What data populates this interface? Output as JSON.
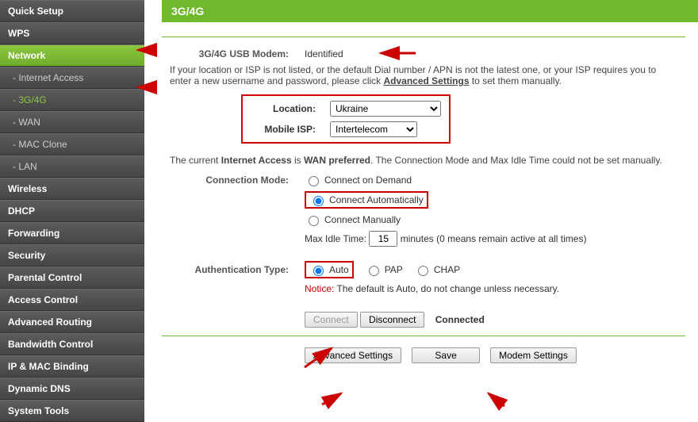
{
  "sidebar": {
    "items": [
      {
        "label": "Quick Setup",
        "type": "top"
      },
      {
        "label": "WPS",
        "type": "top"
      },
      {
        "label": "Network",
        "type": "top",
        "active_parent": true
      },
      {
        "label": "- Internet Access",
        "type": "sub"
      },
      {
        "label": "- 3G/4G",
        "type": "sub",
        "active_sub": true
      },
      {
        "label": "- WAN",
        "type": "sub"
      },
      {
        "label": "- MAC Clone",
        "type": "sub"
      },
      {
        "label": "- LAN",
        "type": "sub"
      },
      {
        "label": "Wireless",
        "type": "top"
      },
      {
        "label": "DHCP",
        "type": "top"
      },
      {
        "label": "Forwarding",
        "type": "top"
      },
      {
        "label": "Security",
        "type": "top"
      },
      {
        "label": "Parental Control",
        "type": "top"
      },
      {
        "label": "Access Control",
        "type": "top"
      },
      {
        "label": "Advanced Routing",
        "type": "top"
      },
      {
        "label": "Bandwidth Control",
        "type": "top"
      },
      {
        "label": "IP & MAC Binding",
        "type": "top"
      },
      {
        "label": "Dynamic DNS",
        "type": "top"
      },
      {
        "label": "System Tools",
        "type": "top"
      }
    ]
  },
  "page": {
    "title": "3G/4G",
    "modem_label": "3G/4G USB Modem:",
    "modem_status": "Identified",
    "note_line_a": "If your location or ISP is not listed, or the default Dial number / APN is not the latest one, or your ISP requires you to",
    "note_line_b_a": "enter a new username and password, please click ",
    "note_line_b_b": "Advanced Settings",
    "note_line_b_c": " to set them manually.",
    "location_label": "Location:",
    "location_value": "Ukraine",
    "isp_label": "Mobile ISP:",
    "isp_value": "Intertelecom",
    "current_text_a": "The current ",
    "current_text_b": "Internet Access",
    "current_text_c": " is ",
    "current_text_d": "WAN preferred",
    "current_text_e": ". The Connection Mode and Max Idle Time could not be set manually.",
    "conn_mode_label": "Connection Mode:",
    "conn_opt1": "Connect on Demand",
    "conn_opt2": "Connect Automatically",
    "conn_opt3": "Connect Manually",
    "idle_label": "Max Idle Time:",
    "idle_value": "15",
    "idle_suffix": "minutes (0 means remain active at all times)",
    "auth_label": "Authentication Type:",
    "auth_opt1": "Auto",
    "auth_opt2": "PAP",
    "auth_opt3": "CHAP",
    "notice_label": "Notice:",
    "notice_text": " The default is Auto, do not change unless necessary.",
    "connect_btn": "Connect",
    "disconnect_btn": "Disconnect",
    "connected_status": "Connected",
    "adv_btn": "Advanced Settings",
    "save_btn": "Save",
    "modem_btn": "Modem Settings"
  }
}
